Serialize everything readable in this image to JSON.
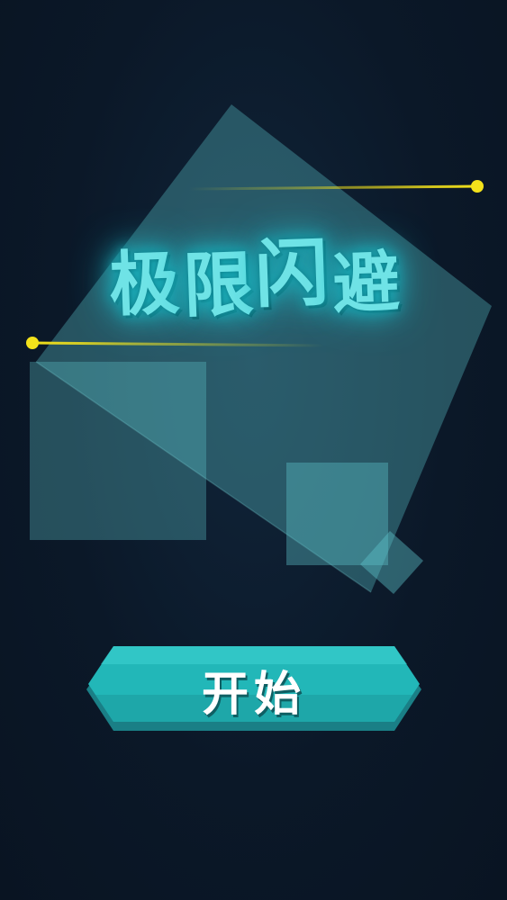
{
  "game": {
    "title_chars": [
      "极",
      "限",
      "闪",
      "避"
    ],
    "start_label": "开始"
  },
  "colors": {
    "background": "#0c1a2b",
    "shape_fill": "#5fc6cc",
    "title_glow": "#6fe3e6",
    "button_fill": "#22b7b8",
    "laser": "#f3e21b"
  }
}
